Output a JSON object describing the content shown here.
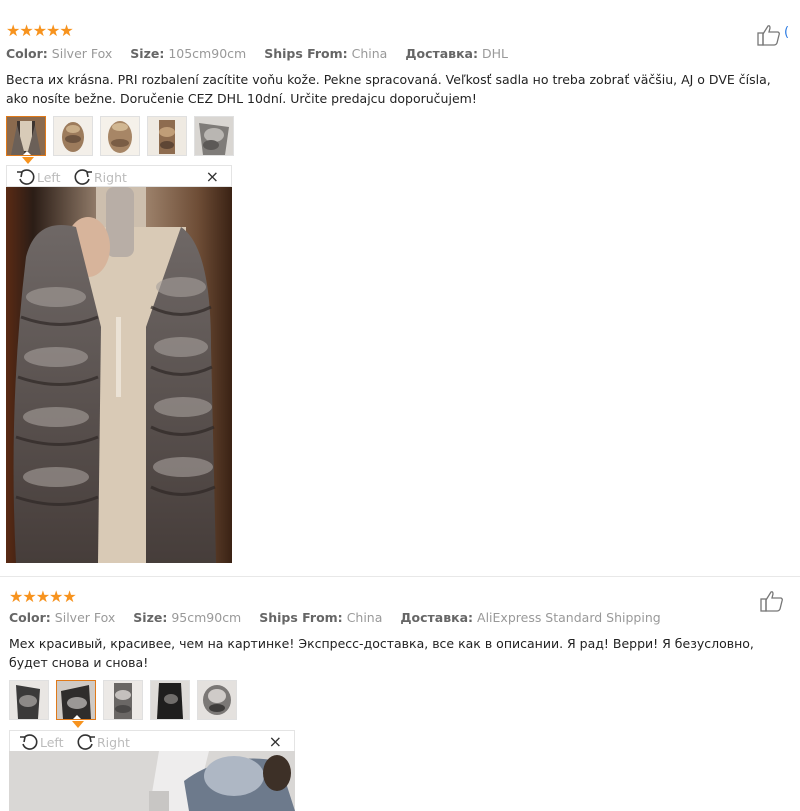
{
  "colors": {
    "star": "#f7931e",
    "active_border": "#e07a1a",
    "muted": "#999999",
    "link": "#2a7ae2"
  },
  "reviews": [
    {
      "stars": "★★★★★",
      "helpful_count": "(",
      "meta": {
        "color_label": "Color:",
        "color_value": "Silver Fox",
        "size_label": "Size:",
        "size_value": "105cm90cm",
        "ships_label": "Ships From:",
        "ships_value": "China",
        "delivery_label": "Доставка:",
        "delivery_value": "DHL"
      },
      "text": "Веста их krásna. PRI rozbalení zacítite voňu kože. Pekne spracovaná. Veľkosť sadla но treba zobrať väčšiu, AJ o DVE čísla, ako nosíte bežne. Doručenie CEZ DHL 10dní. Určite predajcu doporučujem!",
      "thumbnails": [
        "photo-1",
        "photo-2",
        "photo-3",
        "photo-4",
        "photo-5"
      ],
      "active_thumb": 0,
      "viewer": {
        "left_label": "Left",
        "right_label": "Right",
        "close": "×"
      }
    },
    {
      "stars": "★★★★★",
      "meta": {
        "color_label": "Color:",
        "color_value": "Silver Fox",
        "size_label": "Size:",
        "size_value": "95cm90cm",
        "ships_label": "Ships From:",
        "ships_value": "China",
        "delivery_label": "Доставка:",
        "delivery_value": "AliExpress Standard Shipping"
      },
      "text": "Мех красивый, красивее, чем на картинке! Экспресс-доставка, все как в описании. Я рад! Верри! Я безусловно, будет снова и снова!",
      "thumbnails": [
        "photo-1",
        "photo-2",
        "photo-3",
        "photo-4",
        "photo-5"
      ],
      "active_thumb": 1,
      "viewer": {
        "left_label": "Left",
        "right_label": "Right",
        "close": "×"
      }
    }
  ]
}
